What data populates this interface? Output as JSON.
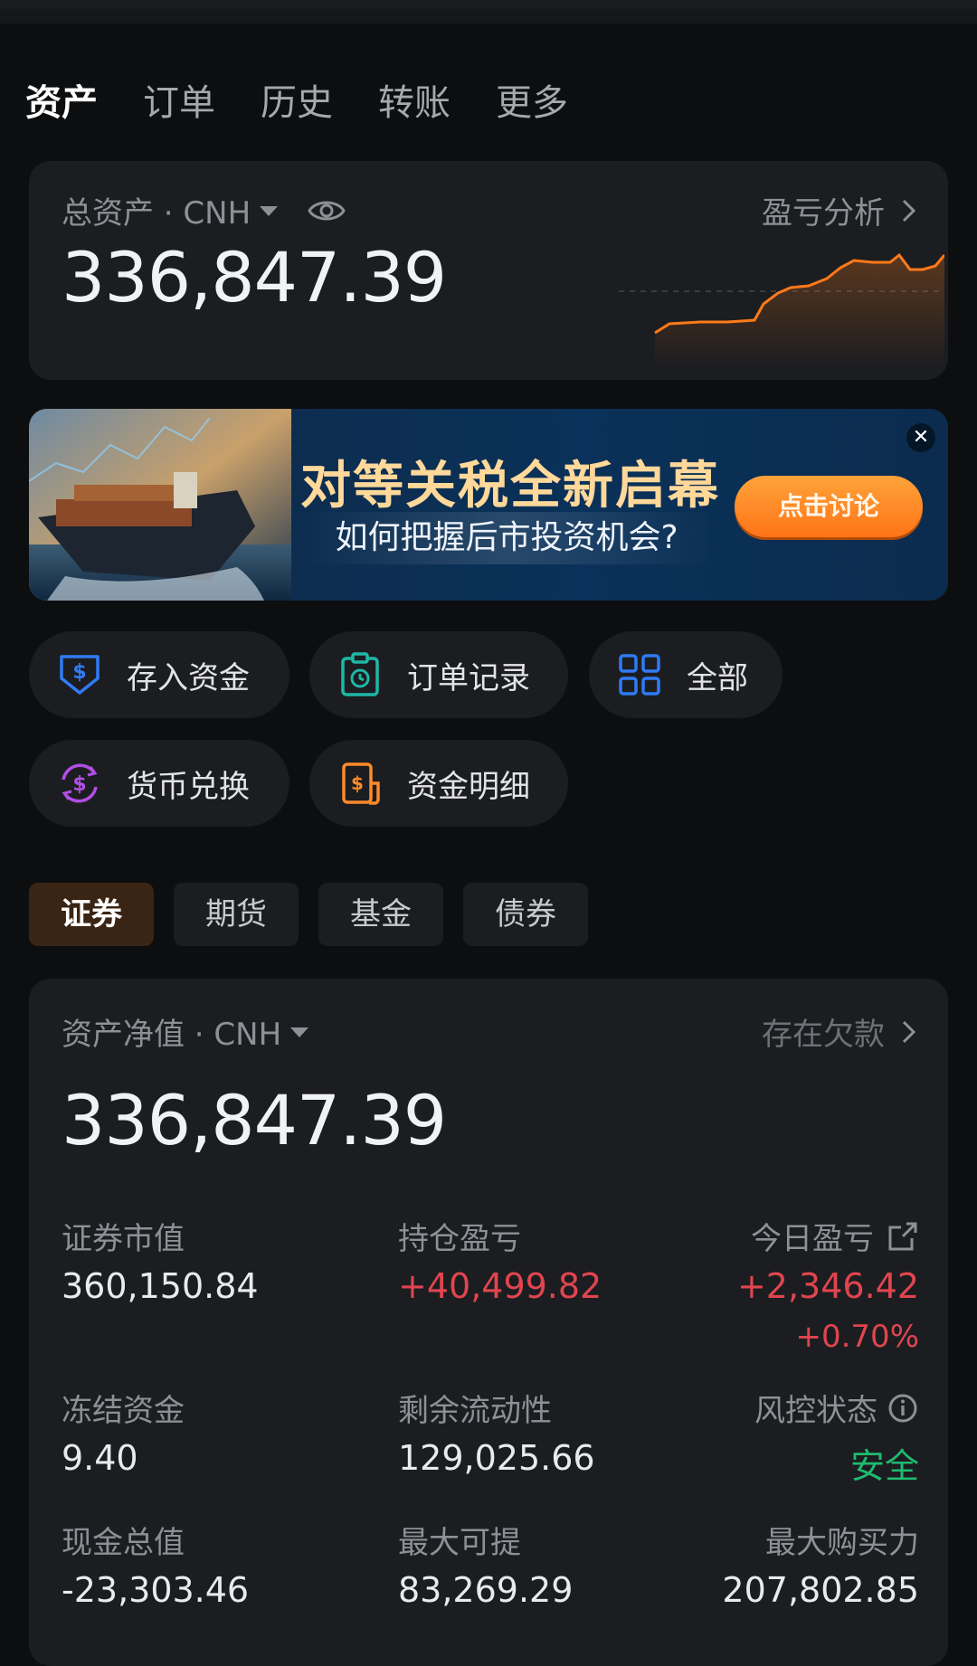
{
  "tabs": [
    "资产",
    "订单",
    "历史",
    "转账",
    "更多"
  ],
  "total_assets": {
    "label": "总资产 · CNH",
    "value": "336,847.39",
    "pnl_link": "盈亏分析",
    "sparkline_color": "#ff7a1a"
  },
  "banner": {
    "title": "对等关税全新启幕",
    "subtitle": "如何把握后市投资机会?",
    "button": "点击讨论"
  },
  "shortcuts": [
    {
      "label": "存入资金",
      "icon": "deposit-icon",
      "color": "#2f7bf6"
    },
    {
      "label": "订单记录",
      "icon": "order-record-icon",
      "color": "#1fb6a6"
    },
    {
      "label": "全部",
      "icon": "grid-icon",
      "color": "#2f7bf6"
    },
    {
      "label": "货币兑换",
      "icon": "currency-exchange-icon",
      "color": "#b04fe6"
    },
    {
      "label": "资金明细",
      "icon": "fund-detail-icon",
      "color": "#ff8a2a"
    }
  ],
  "asset_types": [
    "证券",
    "期货",
    "基金",
    "债券"
  ],
  "net_value": {
    "label": "资产净值 · CNH",
    "value": "336,847.39",
    "debt_link": "存在欠款"
  },
  "stats": {
    "market_value": {
      "label": "证券市值",
      "value": "360,150.84"
    },
    "position_pnl": {
      "label": "持仓盈亏",
      "value": "+40,499.82"
    },
    "today_pnl": {
      "label": "今日盈亏",
      "value": "+2,346.42",
      "percent": "+0.70%"
    },
    "frozen_funds": {
      "label": "冻结资金",
      "value": "9.40"
    },
    "remaining_liquidity": {
      "label": "剩余流动性",
      "value": "129,025.66"
    },
    "risk_status": {
      "label": "风控状态",
      "value": "安全"
    },
    "cash_total": {
      "label": "现金总值",
      "value": "-23,303.46"
    },
    "max_withdraw": {
      "label": "最大可提",
      "value": "83,269.29"
    },
    "max_buying_power": {
      "label": "最大购买力",
      "value": "207,802.85"
    }
  },
  "colors": {
    "accent": "#ff7a1a",
    "up": "#e0454f",
    "safe": "#1fba6f",
    "card": "#1c1d20",
    "background": "#0d0e10"
  }
}
